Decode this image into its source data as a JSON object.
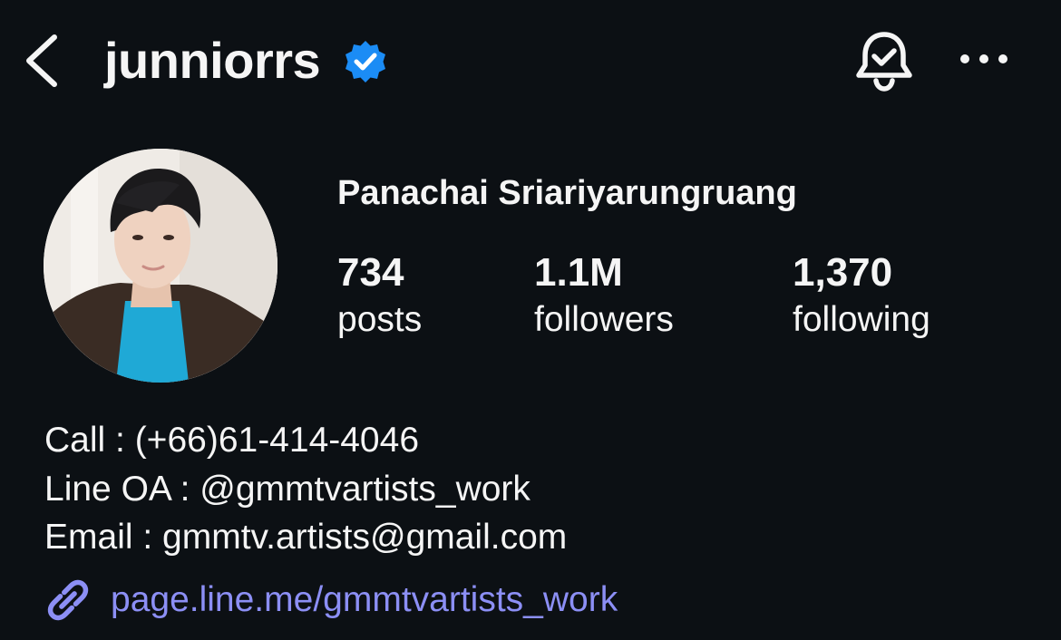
{
  "header": {
    "username": "junniorrs"
  },
  "profile": {
    "full_name": "Panachai Sriariyarungruang",
    "stats": {
      "posts_value": "734",
      "posts_label": "posts",
      "followers_value": "1.1M",
      "followers_label": "followers",
      "following_value": "1,370",
      "following_label": "following"
    },
    "bio": {
      "call": "Call : (+66)61-414-4046",
      "line": "Line OA : @gmmtvartists_work",
      "email": "Email : gmmtv.artists@gmail.com"
    },
    "link": "page.line.me/gmmtvartists_work"
  },
  "colors": {
    "background": "#0c1014",
    "text": "#f5f5f5",
    "verified_badge": "#1b8cf5",
    "link": "#8c8ff5"
  },
  "icons": {
    "back": "chevron-left-icon",
    "verified": "verified-badge-icon",
    "notifications": "bell-check-icon",
    "more": "more-horizontal-icon",
    "link": "link-chain-icon"
  }
}
